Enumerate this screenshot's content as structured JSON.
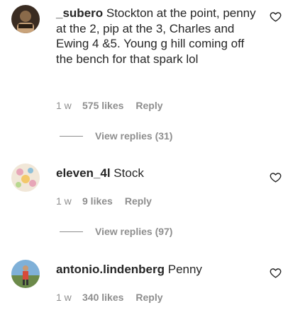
{
  "comments": [
    {
      "username": "_subero",
      "text": "Stockton at the point, penny at the 2, pip at the 3, Charles and Ewing 4 &5. Young g hill coming off the bench for that spark lol",
      "time": "1 w",
      "likes": "575 likes",
      "reply": "Reply",
      "view_replies": "View replies (31)",
      "avatar_colors": [
        "#3a2c22",
        "#8a6a4a",
        "#c9a37a"
      ]
    },
    {
      "username": "eleven_4l",
      "text": "Stock",
      "time": "1 w",
      "likes": "9 likes",
      "reply": "Reply",
      "view_replies": "View replies (97)",
      "avatar_colors": [
        "#f1e7d8",
        "#e7a6b8",
        "#8fc0d8"
      ]
    },
    {
      "username": "antonio.lindenberg",
      "text": "Penny",
      "time": "1 w",
      "likes": "340 likes",
      "reply": "Reply",
      "avatar_colors": [
        "#7fb0d8",
        "#d64a3a",
        "#6c8a4a"
      ]
    }
  ],
  "icons": {
    "like": "heart-outline-icon"
  }
}
